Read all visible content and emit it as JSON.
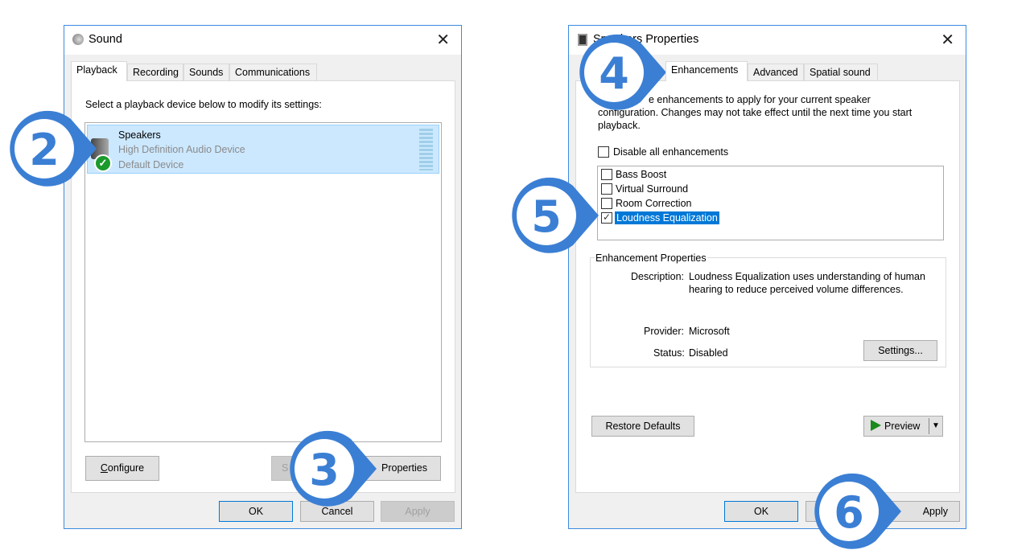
{
  "sound_window": {
    "title": "Sound",
    "tabs": [
      "Playback",
      "Recording",
      "Sounds",
      "Communications"
    ],
    "active_tab": "Playback",
    "instruction": "Select a playback device below to modify its settings:",
    "device": {
      "name": "Speakers",
      "driver": "High Definition Audio Device",
      "status": "Default Device"
    },
    "buttons": {
      "configure": "Configure",
      "set_default": "S",
      "properties": "Properties",
      "ok": "OK",
      "cancel": "Cancel",
      "apply": "Apply"
    }
  },
  "properties_window": {
    "title": "Speakers Properties",
    "title_visible": "S          s Properties",
    "tabs": [
      "Enhancements",
      "Advanced",
      "Spatial sound"
    ],
    "active_tab": "Enhancements",
    "intro_lines": [
      "e enhancements to apply for your current speaker",
      "configuration. Changes may not take effect until the next time you start",
      "playback."
    ],
    "disable_all": {
      "label": "Disable all enhancements",
      "checked": false
    },
    "enhancements": [
      {
        "label": "Bass Boost",
        "checked": false
      },
      {
        "label": "Virtual Surround",
        "checked": false
      },
      {
        "label": "Room Correction",
        "checked": false
      },
      {
        "label": "Loudness Equalization",
        "checked": true,
        "selected": true
      }
    ],
    "group_title": "Enhancement Properties",
    "description_label": "Description:",
    "description_lines": [
      "Loudness Equalization uses understanding of human",
      "hearing to reduce perceived volume differences."
    ],
    "provider_label": "Provider:",
    "provider": "Microsoft",
    "status_label": "Status:",
    "status": "Disabled",
    "buttons": {
      "settings": "Settings...",
      "restore": "Restore Defaults",
      "preview": "Preview",
      "ok": "OK",
      "apply": "Apply"
    }
  },
  "callouts": [
    "2",
    "3",
    "4",
    "5",
    "6"
  ],
  "colors": {
    "accent": "#3b7fd4",
    "selection": "#cce8ff",
    "highlight": "#0078d7"
  }
}
